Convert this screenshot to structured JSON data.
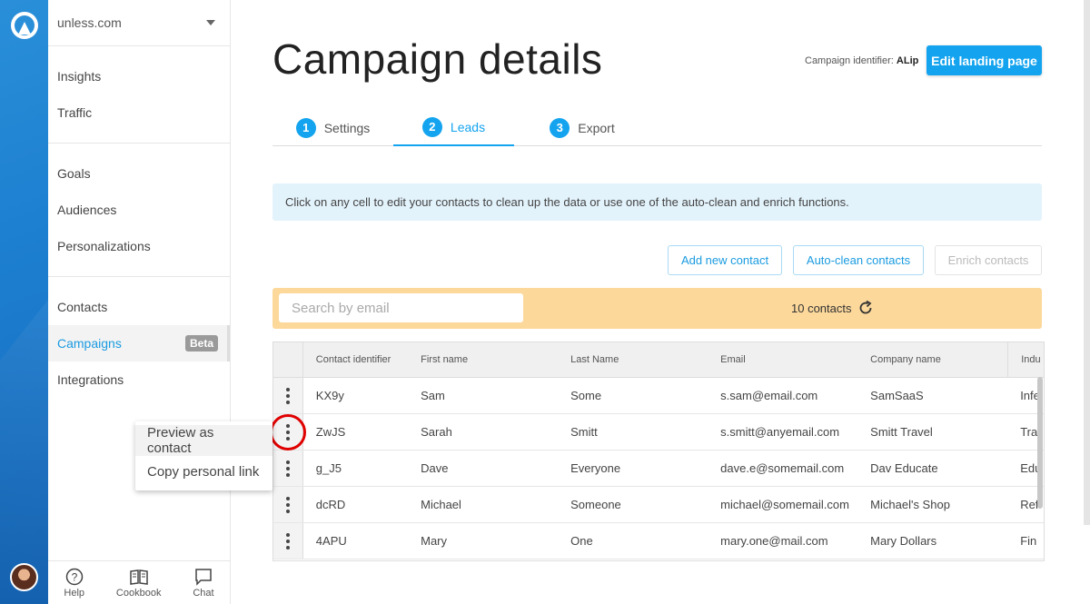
{
  "site": {
    "name": "unless.com"
  },
  "nav": {
    "group1": [
      {
        "label": "Insights"
      },
      {
        "label": "Traffic"
      }
    ],
    "group2": [
      {
        "label": "Goals"
      },
      {
        "label": "Audiences"
      },
      {
        "label": "Personalizations"
      }
    ],
    "group3": [
      {
        "label": "Contacts"
      },
      {
        "label": "Campaigns",
        "badge": "Beta"
      },
      {
        "label": "Integrations"
      }
    ]
  },
  "footer": {
    "help": "Help",
    "cookbook": "Cookbook",
    "chat": "Chat"
  },
  "context_menu": {
    "items": [
      {
        "label": "Preview as contact"
      },
      {
        "label": "Copy personal link"
      }
    ]
  },
  "header": {
    "title": "Campaign details",
    "identifier_label": "Campaign identifier:",
    "identifier_value": "ALip",
    "edit_button": "Edit landing page"
  },
  "tabs": [
    {
      "num": "1",
      "label": "Settings"
    },
    {
      "num": "2",
      "label": "Leads"
    },
    {
      "num": "3",
      "label": "Export"
    }
  ],
  "info_text": "Click on any cell to edit your contacts to clean up the data or use one of the auto-clean and enrich functions.",
  "actions": {
    "add": "Add new contact",
    "autoclean": "Auto-clean contacts",
    "enrich": "Enrich contacts"
  },
  "search": {
    "placeholder": "Search by email",
    "count": "10 contacts"
  },
  "table": {
    "headers": [
      "Contact identifier",
      "First name",
      "Last Name",
      "Email",
      "Company name",
      "Indu"
    ],
    "rows": [
      [
        "KX9y",
        "Sam",
        "Some",
        "s.sam@email.com",
        "SamSaaS",
        "Infe"
      ],
      [
        "ZwJS",
        "Sarah",
        "Smitt",
        "s.smitt@anyemail.com",
        "Smitt Travel",
        "Tra"
      ],
      [
        "g_J5",
        "Dave",
        "Everyone",
        "dave.e@somemail.com",
        "Dav Educate",
        "Edu"
      ],
      [
        "dcRD",
        "Michael",
        "Someone",
        "michael@somemail.com",
        "Michael's Shop",
        "Ref"
      ],
      [
        "4APU",
        "Mary",
        "One",
        "mary.one@mail.com",
        "Mary Dollars",
        "Fin"
      ]
    ]
  },
  "colors": {
    "accent": "#14a4ef",
    "rail": "#1d7fd0",
    "searchbar": "#fcd89b",
    "info": "#e3f3fc"
  }
}
